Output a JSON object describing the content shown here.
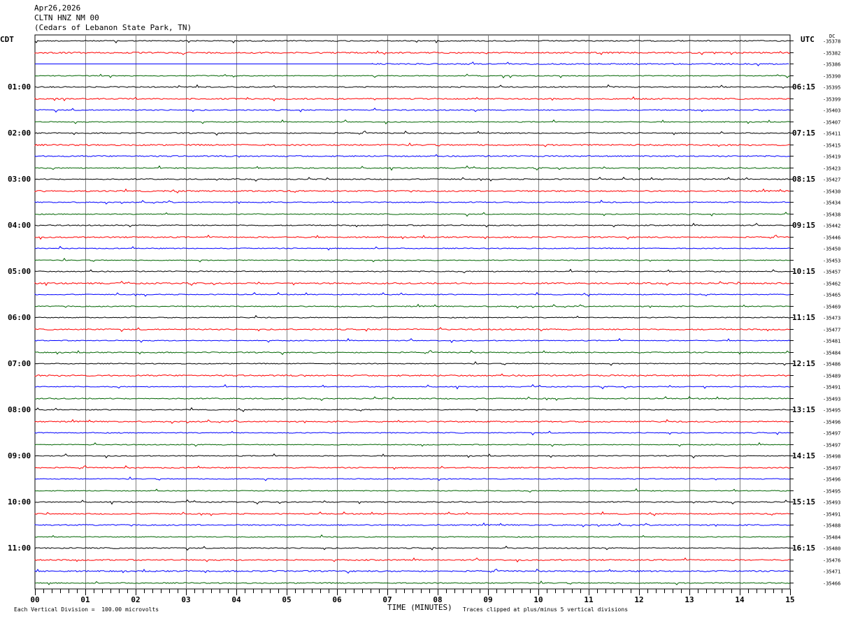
{
  "header": {
    "date": "Apr26,2026",
    "station": "CLTN HNZ NM 00",
    "location": "(Cedars of Lebanon State Park, TN)"
  },
  "labels": {
    "left_timezone": "CDT",
    "right_timezone": "UTC",
    "dc_label": "DC"
  },
  "footer": {
    "scale_note": "Each Vertical Division =  100.00 microvolts",
    "x_axis_title": "TIME (MINUTES)",
    "clip_note": "Traces clipped at plus/minus 5 vertical divisions"
  },
  "colors": {
    "trace_cycle": [
      "#000000",
      "#ff0000",
      "#0000ff",
      "#006400"
    ],
    "grid": "#808080"
  },
  "chart_data": {
    "type": "line",
    "description_type": "helicorder",
    "x_ticks": [
      "00",
      "01",
      "02",
      "03",
      "04",
      "05",
      "06",
      "07",
      "08",
      "09",
      "10",
      "11",
      "12",
      "13",
      "14",
      "15"
    ],
    "x_range": [
      0,
      15
    ],
    "rows_per_hour": 4,
    "left_hour_labels": [
      "01:00",
      "02:00",
      "03:00",
      "04:00",
      "05:00",
      "06:00",
      "07:00",
      "08:00",
      "09:00",
      "10:00",
      "11:00"
    ],
    "right_hour_labels": [
      "06:15",
      "07:15",
      "08:15",
      "09:15",
      "10:15",
      "11:15",
      "12:15",
      "13:15",
      "14:15",
      "15:15",
      "16:15"
    ],
    "dc_offsets": [
      "-35378",
      "-35382",
      "-35386",
      "-35390",
      "-35395",
      "-35399",
      "-35403",
      "-35407",
      "-35411",
      "-35415",
      "-35419",
      "-35423",
      "-35427",
      "-35430",
      "-35434",
      "-35438",
      "-35442",
      "-35446",
      "-35450",
      "-35453",
      "-35457",
      "-35462",
      "-35465",
      "-35469",
      "-35473",
      "-35477",
      "-35481",
      "-35484",
      "-35486",
      "-35489",
      "-35491",
      "-35493",
      "-35495",
      "-35496",
      "-35497",
      "-35497",
      "-35498",
      "-35497",
      "-35496",
      "-35495",
      "-35493",
      "-35491",
      "-35488",
      "-35484",
      "-35480",
      "-35476",
      "-35471",
      "-35466"
    ],
    "trace_start_minute": [
      0,
      0,
      6.7,
      0,
      0,
      0,
      0,
      0,
      0,
      0,
      0,
      0,
      0,
      0,
      0,
      0,
      0,
      0,
      0,
      0,
      0,
      0,
      0,
      0,
      0,
      0,
      0,
      0,
      0,
      0,
      0,
      0,
      0,
      0,
      0,
      0,
      0,
      0,
      0,
      0,
      0,
      0,
      0,
      0,
      0,
      0,
      0,
      0
    ],
    "trace_amplitude": [
      1.2,
      1.6,
      1.4,
      1.0,
      1.2,
      1.4,
      1.2,
      1.0,
      1.2,
      1.6,
      1.4,
      1.2,
      1.2,
      1.6,
      1.2,
      1.0,
      1.2,
      1.4,
      1.0,
      1.0,
      1.2,
      1.6,
      1.0,
      1.2,
      1.0,
      1.4,
      1.0,
      1.2,
      1.0,
      1.6,
      1.0,
      1.2,
      1.0,
      1.4,
      1.0,
      1.0,
      1.0,
      1.2,
      1.0,
      1.0,
      1.2,
      1.2,
      1.4,
      1.0,
      1.2,
      1.4,
      1.6,
      1.2
    ]
  }
}
